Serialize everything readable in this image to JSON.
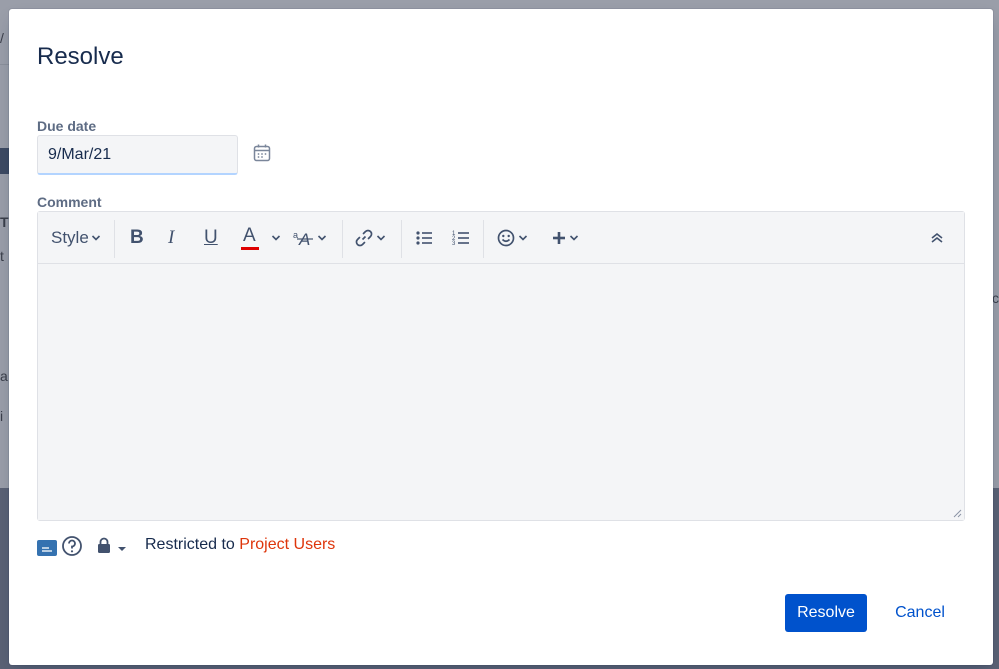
{
  "dialog": {
    "title": "Resolve"
  },
  "due_date": {
    "label": "Due date",
    "value": "9/Mar/21",
    "calendar_icon": "calendar-icon"
  },
  "comment": {
    "label": "Comment",
    "toolbar": {
      "style_label": "Style",
      "bold_glyph": "B",
      "italic_glyph": "I",
      "underline_glyph": "U",
      "text_color_glyph": "A",
      "text_color_underline": "#de0000",
      "icons": [
        "bold-icon",
        "italic-icon",
        "underline-icon",
        "text-color-icon",
        "text-effects-icon",
        "link-icon",
        "bullet-list-icon",
        "numbered-list-icon",
        "emoji-icon",
        "insert-more-icon",
        "collapse-toolbar-icon"
      ]
    },
    "body": ""
  },
  "footer": {
    "restricted_prefix": "Restricted to",
    "restricted_link": "Project Users"
  },
  "actions": {
    "primary_label": "Resolve",
    "cancel_label": "Cancel"
  },
  "colors": {
    "primary": "#0052cc",
    "link_red": "#de350b",
    "text": "#172b4d",
    "muted_label": "#5e6c84"
  }
}
